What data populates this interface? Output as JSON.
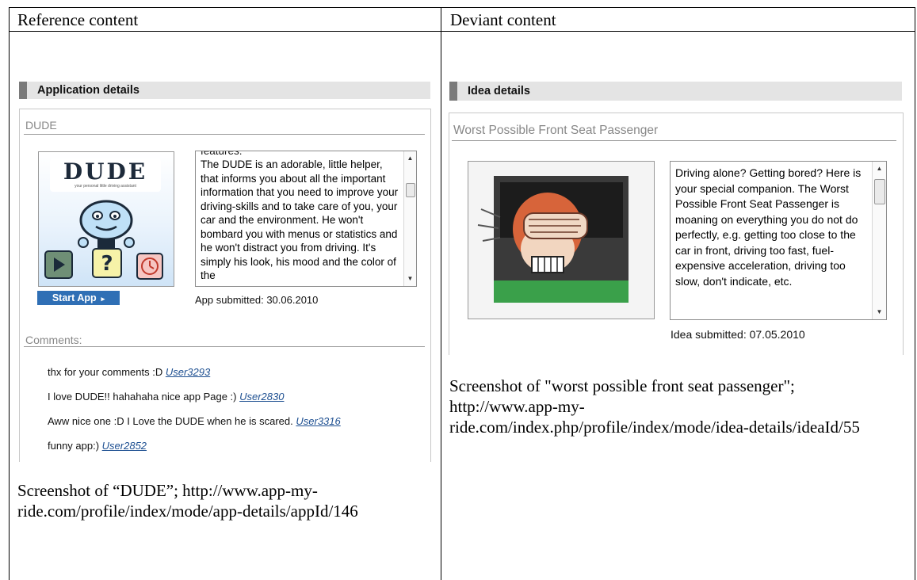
{
  "columns": {
    "left_header": "Reference content",
    "right_header": "Deviant content"
  },
  "left": {
    "section_title": "Application details",
    "app_name": "DUDE",
    "logo_text": "DUDE",
    "logo_tagline": "your personal little driving assistant",
    "description_partial_top": "features:",
    "description": "The DUDE is an adorable, little helper, that informs you about all the important information that you need to improve your driving-skills and to take care of you, your car and the environment. He won't bombard you with menus or statistics and he won't distract you from driving. It's simply his look, his mood and the color of the",
    "start_button": "Start App",
    "submitted": "App submitted: 30.06.2010",
    "comments_label": "Comments:",
    "comments": [
      {
        "text": "thx for your comments :D",
        "user": "User3293"
      },
      {
        "text": "I love DUDE!! hahahaha nice app Page :)",
        "user": "User2830"
      },
      {
        "text": "Aww nice one :D I Love the DUDE when he is scared.",
        "user": "User3316"
      },
      {
        "text": "funny app:)",
        "user": "User2852"
      }
    ],
    "caption": "Screenshot of “DUDE”; http://www.app-my-ride.com/profile/index/mode/app-details/appId/146"
  },
  "right": {
    "section_title": "Idea details",
    "idea_name": "Worst Possible Front Seat Passenger",
    "description": "Driving alone? Getting bored? Here is your special companion. The Worst Possible Front Seat Passenger is moaning on everything you do not do perfectly, e.g. getting too close to the car in front, driving too fast, fuel-expensive acceleration, driving too slow, don't indicate, etc.",
    "submitted": "Idea submitted: 07.05.2010",
    "caption": "Screenshot of \"worst possible front seat passenger\"; http://www.app-my-ride.com/index.php/profile/index/mode/idea-details/ideaId/55"
  },
  "colors": {
    "accent_blue": "#2f6fb5",
    "section_bar": "#e4e4e4",
    "link": "#1d4f91"
  }
}
